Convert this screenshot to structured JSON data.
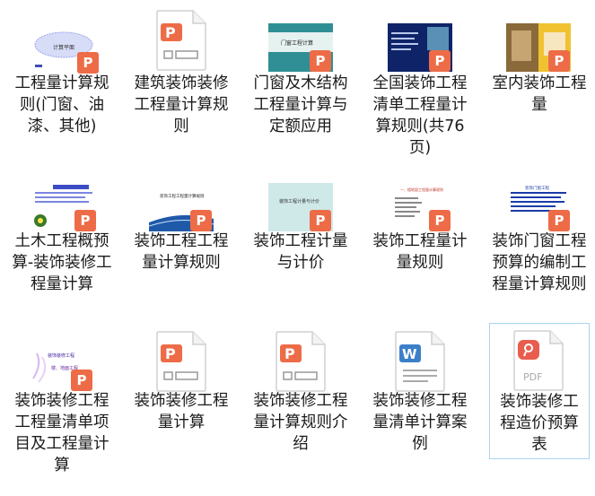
{
  "items": [
    {
      "label": "工程量计算规则(门窗、油漆、其他)"
    },
    {
      "label": "建筑装饰装修工程量计算规则"
    },
    {
      "label": "门窗及木结构工程量计算与定额应用"
    },
    {
      "label": "全国装饰工程清单工程量计算规则(共76页)"
    },
    {
      "label": "室内装饰工程量"
    },
    {
      "label": "土木工程概预算-装饰装修工程量计算"
    },
    {
      "label": "装饰工程工程量计算规则"
    },
    {
      "label": "装饰工程计量与计价"
    },
    {
      "label": "装饰工程量计量规则"
    },
    {
      "label": "装饰门窗工程预算的编制工程量计算规则"
    },
    {
      "label": "装饰装修工程工程量清单项目及工程量计算"
    },
    {
      "label": "装饰装修工程量计算"
    },
    {
      "label": "装饰装修工程量计算规则介绍"
    },
    {
      "label": "装饰装修工程量清单计算案例"
    },
    {
      "label": "装饰装修工程造价预算表"
    }
  ],
  "thumb_text": {
    "t1": "计算平面",
    "t3": "门窗工程计算",
    "t7": "装饰工程工程量计算规则",
    "t8": "装饰工程计量与计价",
    "t9": "一、楼地面工程量计算规则",
    "t10": "装饰门窗工程",
    "t11a": "装饰装修工程",
    "t11b": "楼、地面工程",
    "pdf": "PDF"
  },
  "colors": {
    "ppt": "#ed6c47",
    "word": "#3c7fc9",
    "pdf": "#e85d4e",
    "selected_border": "#a9d4f2"
  },
  "icons": {
    "ppt": "presentation-file-icon",
    "word": "word-file-icon",
    "pdf": "pdf-file-icon"
  }
}
